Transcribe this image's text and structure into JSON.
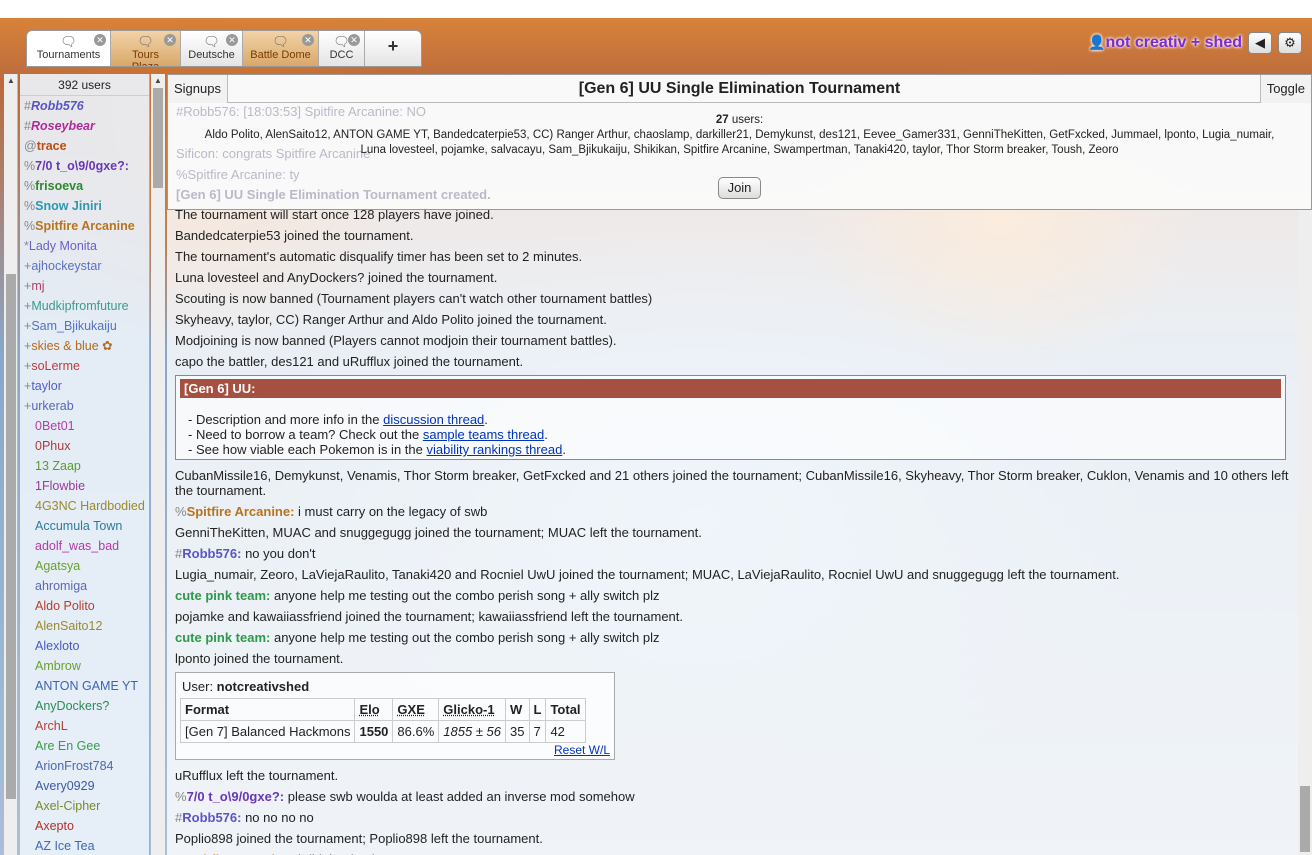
{
  "tabs": [
    {
      "label": "Tournaments",
      "style": "active"
    },
    {
      "label": "Tours Plaza",
      "style": "orange"
    },
    {
      "label": "Deutsche",
      "style": "normal"
    },
    {
      "label": "Battle Dome",
      "style": "orange"
    },
    {
      "label": "DCC",
      "style": "normal"
    }
  ],
  "add_tab": "+",
  "user_bar": {
    "username": "not creativ + shed",
    "sound_icon": "speaker-icon",
    "settings_icon": "gear-icon"
  },
  "userlist": {
    "count": "392 users",
    "users": [
      {
        "rank": "#",
        "name": "Robb576",
        "color": "#5a54c8",
        "style": "bi"
      },
      {
        "rank": "#",
        "name": "Roseybear",
        "color": "#b22a99",
        "style": "bi"
      },
      {
        "rank": "@",
        "name": "trace",
        "color": "#bc4c10",
        "style": "b"
      },
      {
        "rank": "%",
        "name": "7/0 t_o\\9/0gxe?:",
        "color": "#6a36b8",
        "style": "b"
      },
      {
        "rank": "%",
        "name": "frisoeva",
        "color": "#2c8a2a",
        "style": "b"
      },
      {
        "rank": "%",
        "name": "Snow Jiniri",
        "color": "#2d97b0",
        "style": "b"
      },
      {
        "rank": "%",
        "name": "Spitfire Arcanine",
        "color": "#b8731e",
        "style": "b"
      },
      {
        "rank": "*",
        "name": "Lady Monita",
        "color": "#6b5fc9",
        "style": ""
      },
      {
        "rank": "+",
        "name": "ajhockeystar",
        "color": "#5a70c4",
        "style": ""
      },
      {
        "rank": "+",
        "name": "mj",
        "color": "#b03e6a",
        "style": ""
      },
      {
        "rank": "+",
        "name": "Mudkipfromfuture",
        "color": "#3c9a8a",
        "style": ""
      },
      {
        "rank": "+",
        "name": "Sam_Bjikukaiju",
        "color": "#5472c2",
        "style": ""
      },
      {
        "rank": "+",
        "name": "skies & blue ✿",
        "color": "#b36a1f",
        "style": ""
      },
      {
        "rank": "+",
        "name": "soLerme",
        "color": "#bc3c3c",
        "style": ""
      },
      {
        "rank": "+",
        "name": "taylor",
        "color": "#5060c8",
        "style": ""
      },
      {
        "rank": "+",
        "name": "urkerab",
        "color": "#5a66b4",
        "style": ""
      },
      {
        "rank": "",
        "name": "0Bet01",
        "color": "#b23fa0",
        "style": ""
      },
      {
        "rank": "",
        "name": "0Phux",
        "color": "#b03a3a",
        "style": ""
      },
      {
        "rank": "",
        "name": "13 Zaap",
        "color": "#5b9a2b",
        "style": ""
      },
      {
        "rank": "",
        "name": "1Flowbie",
        "color": "#9a3a9a",
        "style": ""
      },
      {
        "rank": "",
        "name": "4G3NC Hardbodied",
        "color": "#9a8a2a",
        "style": ""
      },
      {
        "rank": "",
        "name": "Accumula Town",
        "color": "#2e7a9e",
        "style": ""
      },
      {
        "rank": "",
        "name": "adolf_was_bad",
        "color": "#b43aa6",
        "style": ""
      },
      {
        "rank": "",
        "name": "Agatsya",
        "color": "#6aa02c",
        "style": ""
      },
      {
        "rank": "",
        "name": "ahromiga",
        "color": "#5b6ab4",
        "style": ""
      },
      {
        "rank": "",
        "name": "Aldo Polito",
        "color": "#b4402c",
        "style": ""
      },
      {
        "rank": "",
        "name": "AlenSaito12",
        "color": "#9a8a2a",
        "style": ""
      },
      {
        "rank": "",
        "name": "Alexloto",
        "color": "#4a58c4",
        "style": ""
      },
      {
        "rank": "",
        "name": "Ambrow",
        "color": "#6aa02c",
        "style": ""
      },
      {
        "rank": "",
        "name": "ANTON GAME YT",
        "color": "#3c64b4",
        "style": ""
      },
      {
        "rank": "",
        "name": "AnyDockers?",
        "color": "#2c8a5a",
        "style": ""
      },
      {
        "rank": "",
        "name": "ArchL",
        "color": "#b4403a",
        "style": ""
      },
      {
        "rank": "",
        "name": "Are En Gee",
        "color": "#3c9a4a",
        "style": ""
      },
      {
        "rank": "",
        "name": "ArionFrost784",
        "color": "#4a68b4",
        "style": ""
      },
      {
        "rank": "",
        "name": "Avery0929",
        "color": "#3c5aa4",
        "style": ""
      },
      {
        "rank": "",
        "name": "Axel-Cipher",
        "color": "#7a8a2a",
        "style": ""
      },
      {
        "rank": "",
        "name": "Axepto",
        "color": "#b4302a",
        "style": ""
      },
      {
        "rank": "",
        "name": "AZ Ice Tea",
        "color": "#3c6ab4",
        "style": ""
      }
    ]
  },
  "tournament": {
    "signups_label": "Signups",
    "title": "[Gen 6] UU Single Elimination Tournament",
    "toggle_label": "Toggle",
    "user_count": "27",
    "user_count_suffix": " users:",
    "users_line1": "Aldo Polito, AlenSaito12, ANTON GAME YT, Bandedcaterpie53, CC) Ranger Arthur, chaoslamp, darkiller21, Demykunst, des121, Eevee_Gamer331, GenniTheKitten, GetFxcked, Jummael, lponto, Lugia_numair,",
    "users_line2": "Luna lovesteel, pojamke, salvacayu, Sam_Bjikukaiju, Shikikan, Spitfire Arcanine, Swampertman, Tanaki420, taylor, Thor Storm breaker, Toush, Zeoro",
    "join_label": "Join",
    "ghost_lines": [
      "#Robb576:  [18:03:53] Spitfire Arcanine: NO",
      "Sificon:  congrats Spitfire Arcanine",
      "%Spitfire Arcanine:  ty",
      "[Gen 6] UU Single Elimination Tournament created."
    ]
  },
  "messages_a": [
    "The tournament will start once 128 players have joined.",
    "Bandedcaterpie53 joined the tournament.",
    "The tournament's automatic disqualify timer has been set to 2 minutes.",
    "Luna lovesteel and AnyDockers? joined the tournament.",
    "Scouting is now banned (Tournament players can't watch other tournament battles)",
    "Skyheavy, taylor, CC) Ranger Arthur and Aldo Polito joined the tournament.",
    "Modjoining is now banned (Players cannot modjoin their tournament battles).",
    "capo the battler, des121 and uRufflux joined the tournament."
  ],
  "infobox": {
    "header": "[Gen 6] UU:",
    "line1_pre": "- Description and more info in the ",
    "line1_link": "discussion thread",
    "line1_post": ".",
    "line2_pre": "- Need to borrow a team? Check out the ",
    "line2_link": "sample teams thread",
    "line2_post": ".",
    "line3_pre": "- See how viable each Pokemon is in the ",
    "line3_link": "viability rankings thread",
    "line3_post": "."
  },
  "messages_b": [
    {
      "type": "sys",
      "text": "CubanMissile16, Demykunst, Venamis, Thor Storm breaker, GetFxcked and 21 others joined the tournament; CubanMissile16, Skyheavy, Thor Storm breaker, Cuklon, Venamis and 10 others left the tournament."
    },
    {
      "type": "chat",
      "rank": "%",
      "name": "Spitfire Arcanine:",
      "color": "#b8731e",
      "text": " i must carry on the legacy of swb"
    },
    {
      "type": "sys",
      "text": "GenniTheKitten, MUAC and snuggegugg joined the tournament; MUAC left the tournament."
    },
    {
      "type": "chat",
      "rank": "#",
      "name": "Robb576:",
      "color": "#5a54c8",
      "text": " no you don't"
    },
    {
      "type": "sys",
      "text": "Lugia_numair, Zeoro, LaViejaRaulito, Tanaki420 and Rocniel UwU joined the tournament; MUAC, LaViejaRaulito, Rocniel UwU and snuggegugg left the tournament."
    },
    {
      "type": "chat",
      "rank": "",
      "name": "cute pink team:",
      "color": "#2c9a4a",
      "text": " anyone help me testing out the combo perish song + ally switch plz"
    },
    {
      "type": "sys",
      "text": "pojamke and kawaiiassfriend joined the tournament; kawaiiassfriend left the tournament."
    },
    {
      "type": "chat",
      "rank": "",
      "name": "cute pink team:",
      "color": "#2c9a4a",
      "text": " anyone help me testing out the combo perish song + ally switch plz"
    },
    {
      "type": "sys",
      "text": "lponto joined the tournament."
    }
  ],
  "stats": {
    "user_label": "User: ",
    "user_name": "notcreativshed",
    "headers": [
      "Format",
      "Elo",
      "GXE",
      "Glicko-1",
      "W",
      "L",
      "Total"
    ],
    "row": [
      "[Gen 7] Balanced Hackmons",
      "1550",
      "86.6%",
      "1855 ± 56",
      "35",
      "7",
      "42"
    ],
    "reset": "Reset W/L"
  },
  "messages_c": [
    {
      "type": "sys",
      "text": "uRufflux left the tournament."
    },
    {
      "type": "chat",
      "rank": "%",
      "name": "7/0 t_o\\9/0gxe?:",
      "color": "#6a36b8",
      "text": " please swb woulda at least added an inverse mod somehow"
    },
    {
      "type": "chat",
      "rank": "#",
      "name": "Robb576:",
      "color": "#5a54c8",
      "text": " no no no no"
    },
    {
      "type": "sys",
      "text": "Poplio898 joined the tournament; Poplio898 left the tournament."
    },
    {
      "type": "chat",
      "rank": "%",
      "name": "Spitfire Arcanine:",
      "color": "#b8731e",
      "text": " i did that in plaza"
    }
  ]
}
